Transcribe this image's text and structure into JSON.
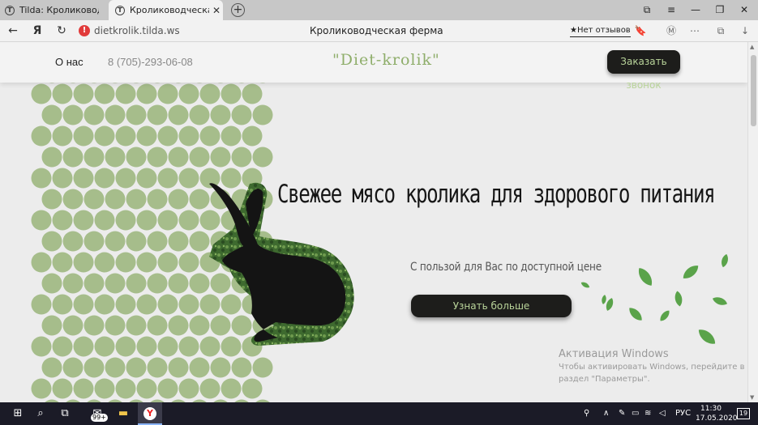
{
  "browser": {
    "tabs": [
      {
        "label": "Tilda: Кролиководческая",
        "favicon": "T"
      },
      {
        "label": "Кролиководческая фер",
        "favicon": "T",
        "active": true
      }
    ],
    "new_tab_icon": "+",
    "window_controls": [
      "⧉",
      "≡",
      "—",
      "❐",
      "✕"
    ],
    "url": "dietkrolik.tilda.ws",
    "page_title": "Кролиководческая ферма",
    "reviews": "★Нет отзывов",
    "nav_back": "←",
    "nav_logo": "Я",
    "nav_reload": "↻",
    "warning": "!",
    "toolbar_icons": [
      "🔖",
      "Ⓜ",
      "⋯",
      "⧉",
      "↓"
    ]
  },
  "site": {
    "nav_about": "О нас",
    "phone": "8 (705)-293-06-08",
    "logo": "\"Diet-krolik\"",
    "call_button": "Заказать звонок",
    "headline": "Свежее мясо кролика для здорового питания",
    "subline": "С пользой для Вас по доступной цене",
    "more_button": "Узнать больше"
  },
  "activation": {
    "title": "Активация Windows",
    "line1": "Чтобы активировать Windows, перейдите в",
    "line2": "раздел \"Параметры\"."
  },
  "taskbar": {
    "mail_badge": "99+",
    "lang": "РУС",
    "time": "11:30",
    "date": "17.05.2020",
    "notifications": "19"
  },
  "colors": {
    "circle": "#a6bd8b",
    "accent_green": "#8fae6b",
    "button_bg": "#1d1d1b",
    "button_text": "#b9d49a"
  }
}
